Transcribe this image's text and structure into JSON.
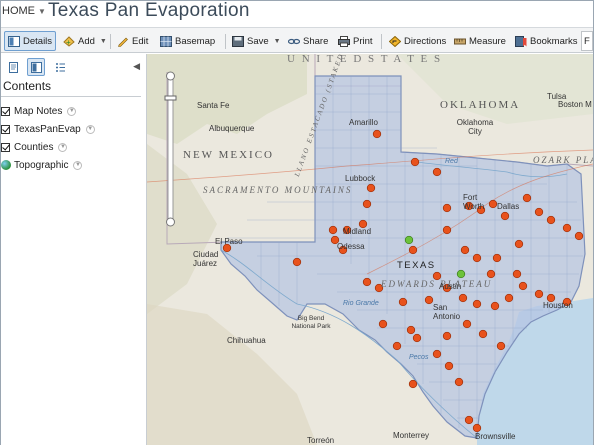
{
  "title_bar": {
    "home_label": "HOME",
    "map_title": "Texas Pan Evaporation"
  },
  "toolbar": {
    "details_label": "Details",
    "add_label": "Add",
    "edit_label": "Edit",
    "basemap_label": "Basemap",
    "save_label": "Save",
    "share_label": "Share",
    "print_label": "Print",
    "directions_label": "Directions",
    "measure_label": "Measure",
    "bookmarks_label": "Bookmarks",
    "find_label": "F"
  },
  "panel": {
    "contents_label": "Contents",
    "layers": [
      {
        "label": "Map Notes",
        "checked": true
      },
      {
        "label": "TexasPanEvap",
        "checked": true
      },
      {
        "label": "Counties",
        "checked": true
      },
      {
        "label": "Topographic",
        "checked": false,
        "icon": "basemap-globe-icon"
      }
    ]
  },
  "map": {
    "region_labels": [
      "NEW MEXICO",
      "OKLAHOMA",
      "TEXAS",
      "SACRAMENTO MOUNTAINS",
      "EDWARDS PLATEAU",
      "OZARK PLATEAU",
      "LLANO ESTACADO (STAKED PLAIN)",
      "U N I T E D   S T A T E S"
    ],
    "city_labels": [
      "Santa Fe",
      "Albuquerque",
      "Amarillo",
      "Lubbock",
      "Midland",
      "Odessa",
      "El Paso",
      "Ciudad Juárez",
      "Chihuahua",
      "Fort Worth",
      "Dallas",
      "Oklahoma City",
      "Tulsa",
      "Austin",
      "San Antonio",
      "Houston",
      "Brownsville",
      "Monterrey",
      "Torreón",
      "Big Bend National Park",
      "Boston M"
    ],
    "water_labels": [
      "Red",
      "Rio Grande",
      "Pecos"
    ],
    "colors": {
      "texas_fill": "#b5c4e3",
      "station_point": "#e8521c",
      "selected_point": "#6cc23a",
      "land": "#e9e6dc",
      "water": "#bfd8ea"
    }
  }
}
